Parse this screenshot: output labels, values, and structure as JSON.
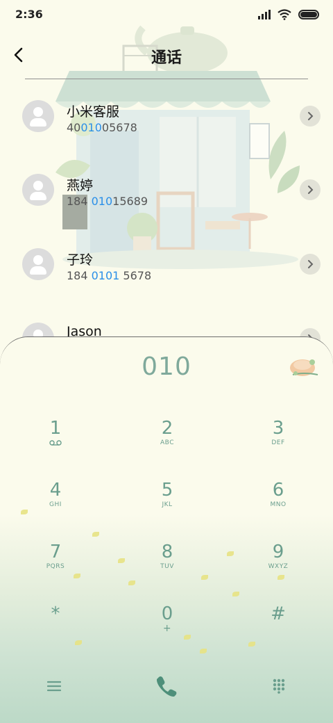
{
  "status_bar": {
    "time": "2:36"
  },
  "header": {
    "title": "通话"
  },
  "contacts": [
    {
      "name": "小米客服",
      "number_pre": "40",
      "number_hl": "010",
      "number_post": "05678"
    },
    {
      "name": "燕婷",
      "number_pre": "184 ",
      "number_hl": "010",
      "number_post": "15689"
    },
    {
      "name": "子玲",
      "number_pre": "184 ",
      "number_hl": "0101",
      "number_post": " 5678"
    },
    {
      "name": "Jason",
      "number_pre": "",
      "number_hl": "",
      "number_post": ""
    }
  ],
  "dialpad": {
    "dialed": "010",
    "keys": [
      {
        "digit": "1",
        "letters": ""
      },
      {
        "digit": "2",
        "letters": "ABC"
      },
      {
        "digit": "3",
        "letters": "DEF"
      },
      {
        "digit": "4",
        "letters": "GHI"
      },
      {
        "digit": "5",
        "letters": "JKL"
      },
      {
        "digit": "6",
        "letters": "MNO"
      },
      {
        "digit": "7",
        "letters": "PQRS"
      },
      {
        "digit": "8",
        "letters": "TUV"
      },
      {
        "digit": "9",
        "letters": "WXYZ"
      },
      {
        "digit": "*",
        "letters": ""
      },
      {
        "digit": "0",
        "letters": "+"
      },
      {
        "digit": "#",
        "letters": ""
      }
    ]
  },
  "colors": {
    "accent": "#6a9e8d",
    "highlight": "#2a8fe8",
    "background": "#fbfbec"
  },
  "icons": {
    "back": "chevron-left-icon",
    "detail": "chevron-right-icon",
    "voicemail": "voicemail-icon",
    "menu": "menu-icon",
    "call": "phone-icon",
    "dialpad": "dialpad-grid-icon"
  }
}
